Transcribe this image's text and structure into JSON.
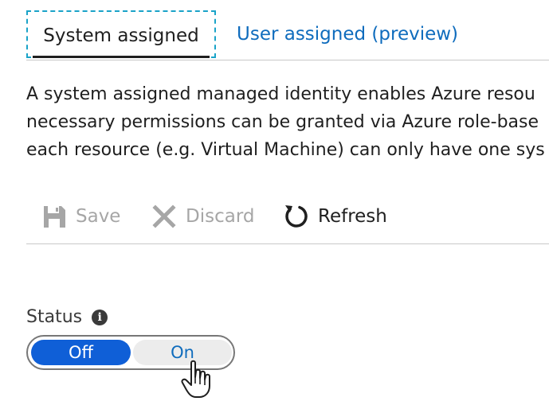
{
  "tabs": [
    {
      "label": "System assigned",
      "active": true
    },
    {
      "label": "User assigned (preview)",
      "active": false
    }
  ],
  "description": {
    "line1": "A system assigned managed identity enables Azure resou",
    "line2": "necessary permissions can be granted via Azure role-base",
    "line3": "each resource (e.g. Virtual Machine) can only have one sys"
  },
  "toolbar": {
    "save_label": "Save",
    "discard_label": "Discard",
    "refresh_label": "Refresh",
    "save_icon": "save-icon",
    "discard_icon": "close-icon",
    "refresh_icon": "refresh-icon"
  },
  "status": {
    "label": "Status",
    "info_icon": "info-icon",
    "off_label": "Off",
    "on_label": "On",
    "selected": "Off"
  },
  "colors": {
    "accent": "#0f5fd7",
    "link": "#0f6cbd",
    "disabled": "#a6a6a6",
    "focus_outline": "#1aa3c8"
  }
}
